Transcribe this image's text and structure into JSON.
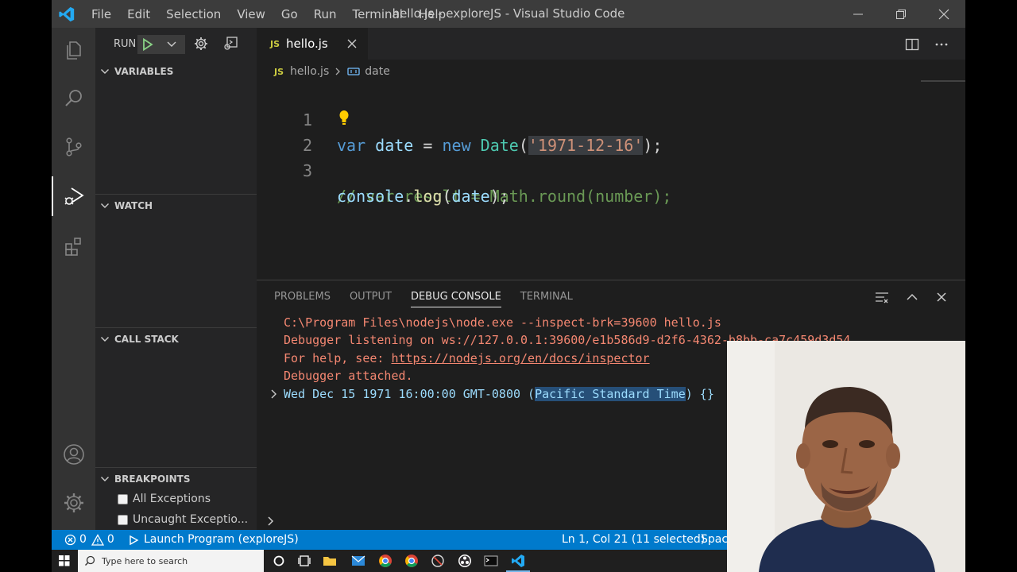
{
  "window": {
    "title": "hello.js - exploreJS - Visual Studio Code",
    "menu": [
      "File",
      "Edit",
      "Selection",
      "View",
      "Go",
      "Run",
      "Terminal",
      "Help"
    ]
  },
  "sidebar": {
    "run_label": "RUN",
    "sections": {
      "variables": "VARIABLES",
      "watch": "WATCH",
      "call_stack": "CALL STACK",
      "breakpoints": "BREAKPOINTS"
    },
    "breakpoints": [
      {
        "label": "All Exceptions",
        "checked": false
      },
      {
        "label": "Uncaught Exceptio...",
        "checked": false
      }
    ]
  },
  "editor": {
    "tab": {
      "badge": "JS",
      "label": "hello.js"
    },
    "breadcrumb": {
      "badge": "JS",
      "file": "hello.js",
      "symbol": "date"
    },
    "lines": [
      {
        "num": "1"
      },
      {
        "num": "2"
      },
      {
        "num": "3"
      }
    ],
    "code": {
      "l1": {
        "kw": "var",
        "name": "date",
        "eq": "=",
        "new": "new",
        "cls": "Date",
        "str": "'1971-12-16'",
        "end": ");"
      },
      "l2": {
        "comment": "// var result = Math.round(number);"
      },
      "l3": {
        "obj": "console",
        "fn": "log",
        "arg": "date",
        "end": ");"
      }
    }
  },
  "panel": {
    "tabs": [
      "PROBLEMS",
      "OUTPUT",
      "DEBUG CONSOLE",
      "TERMINAL"
    ],
    "active_tab": "DEBUG CONSOLE",
    "console": {
      "line1": "C:\\Program Files\\nodejs\\node.exe --inspect-brk=39600 hello.js",
      "line2": "Debugger listening on ws://127.0.0.1:39600/e1b586d9-d2f6-4362-b8bb-ca7c459d3d54",
      "line3_prefix": "For help, see: ",
      "line3_link": "https://nodejs.org/en/docs/inspector",
      "line4": "Debugger attached.",
      "out_pre": "Wed Dec 15 1971 16:00:00 GMT-0800 (",
      "out_sel": "Pacific Standard Time",
      "out_post": ") {}"
    }
  },
  "status": {
    "errors": "0",
    "warnings": "0",
    "launch": "Launch Program (exploreJS)",
    "position": "Ln 1, Col 21 (11 selected)",
    "spaces": "Spac"
  },
  "taskbar": {
    "search_placeholder": "Type here to search"
  },
  "colors": {
    "accent": "#007acc",
    "run_green": "#89d185",
    "error": "#f48771"
  }
}
